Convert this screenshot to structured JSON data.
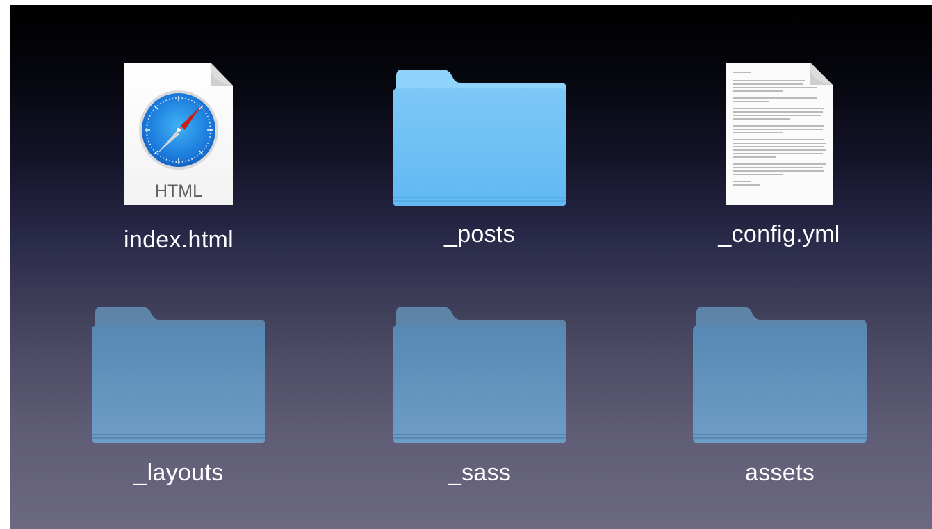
{
  "files": [
    {
      "name": "index.html",
      "kind": "html-file",
      "badge": "HTML"
    },
    {
      "name": "_posts",
      "kind": "folder-selected"
    },
    {
      "name": "_config.yml",
      "kind": "text-file",
      "doc_text": [
        "Dear Kodi,",
        "Here's to the crazy ones. The misfits. The rebels. The troublemakers. The round pegs in the square holes. The ones who see things differently.",
        "They're not fond of rules. And they have no respect for the status quo.",
        "You can praise them, disagree with them, quote them, disbelieve them, glorify or vilify them. About the only thing you can't do is ignore them. Because they change things.",
        "They invent. They imagine. They heal. They explore. They create. They inspire. They push the human race forward.",
        "Maybe they have to be crazy.",
        "While some see them as the crazy ones, we see genius.",
        "Take care,",
        "John Appleseed"
      ]
    },
    {
      "name": "_layouts",
      "kind": "folder"
    },
    {
      "name": "_sass",
      "kind": "folder"
    },
    {
      "name": "assets",
      "kind": "folder"
    }
  ],
  "colors": {
    "folder_selected_back": "#7cc8f6",
    "folder_selected_front": "#66bdf7",
    "folder_back": "#5d84a8",
    "folder_front": "#6a9bc4",
    "label": "#ffffff"
  }
}
